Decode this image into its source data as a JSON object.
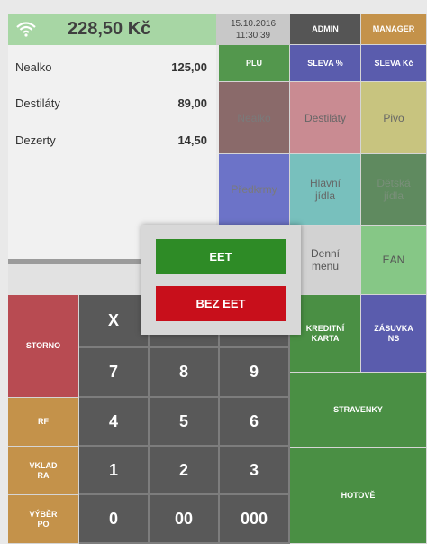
{
  "header": {
    "amount": "228,50 Kč",
    "date": "15.10.2016",
    "time": "11:30:39",
    "admin_label": "ADMIN",
    "manager_label": "MANAGER"
  },
  "items": [
    {
      "name": "Nealko",
      "price": "125,00"
    },
    {
      "name": "Destiláty",
      "price": "89,00"
    },
    {
      "name": "Dezerty",
      "price": "14,50"
    }
  ],
  "function_buttons": {
    "plu": "PLU",
    "sleva_pct": "SLEVA %",
    "sleva_kc": "SLEVA Kč"
  },
  "categories": {
    "nealko": "Nealko",
    "destilaty": "Destiláty",
    "pivo": "Pivo",
    "predkrmy": "Předkrmy",
    "hlavni_line1": "Hlavní",
    "hlavni_line2": "jídla",
    "detska_line1": "Dětská",
    "detska_line2": "jídla",
    "denni_line1": "Denní",
    "denni_line2": "menu",
    "ean": "EAN"
  },
  "left_actions": {
    "storno": "STORNO",
    "rf": "RF",
    "vklad_line1": "VKLAD",
    "vklad_line2": "RA",
    "vyber_line1": "VÝBĚR",
    "vyber_line2": "PO"
  },
  "keypad": {
    "x": "X",
    "k7": "7",
    "k8": "8",
    "k9": "9",
    "k4": "4",
    "k5": "5",
    "k6": "6",
    "k1": "1",
    "k2": "2",
    "k3": "3",
    "k0": "0",
    "k00": "00",
    "k000": "000"
  },
  "payment": {
    "kreditni_line1": "KREDITNÍ",
    "kreditni_line2": "KARTA",
    "zasuvka_line1": "ZÁSUVKA",
    "zasuvka_line2": "NS",
    "stravenky": "STRAVENKY",
    "hotove": "HOTOVĚ"
  },
  "modal": {
    "eet_label": "EET",
    "bez_eet_label": "BEZ EET"
  },
  "colors": {
    "status_bar": "#a7d6a4",
    "admin": "#555555",
    "manager": "#c4924a",
    "plu": "#53974d",
    "sleva": "#5a5cad",
    "nealko": "#8a6a6a",
    "destilaty": "#c98b92",
    "pivo": "#c8c47f",
    "predkrmy": "#6c73c8",
    "hlavni": "#78c0bd",
    "detska": "#5f8a5f",
    "denni": "#d2d2d2",
    "ean": "#86c786",
    "storno": "#b84b52",
    "action": "#c4924a",
    "keypad": "#595959",
    "payment_green": "#4a8f44",
    "payment_blue": "#5a5cad",
    "eet": "#2e8b26",
    "bez_eet": "#c80f1b"
  },
  "icons": {
    "wifi": "wifi-icon"
  }
}
